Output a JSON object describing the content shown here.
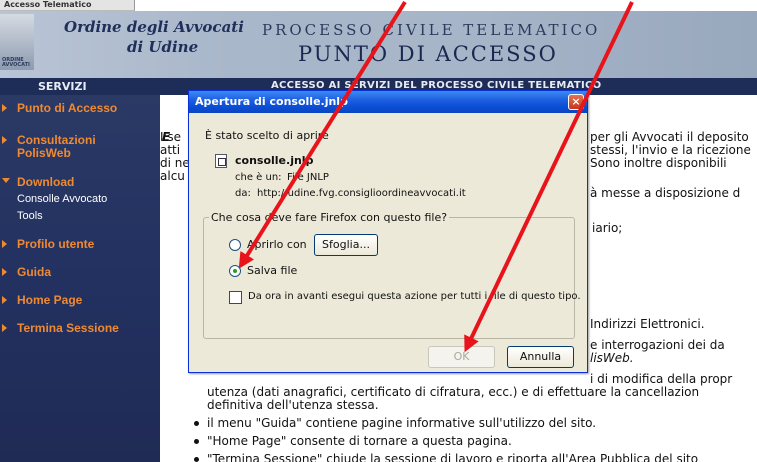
{
  "browser": {
    "tab_title": "Accesso Telematico"
  },
  "header": {
    "crest_label": "ORDINE AVVOCATI",
    "org_line1": "Ordine degli Avvocati",
    "org_line2": "di Udine",
    "pct_line1": "PROCESSO CIVILE TELEMATICO",
    "pct_line2": "PUNTO DI ACCESSO"
  },
  "nav": {
    "servizi_label": "SERVIZI",
    "title": "ACCESSO AI SERVIZI DEL PROCESSO CIVILE TELEMATICO"
  },
  "sidebar": {
    "items": [
      {
        "label": "Punto di Accesso"
      },
      {
        "label": "Consultazioni"
      },
      {
        "label": "PolisWeb"
      },
      {
        "label": "Download"
      },
      {
        "label": "Profilo utente"
      },
      {
        "label": "Guida"
      },
      {
        "label": "Home Page"
      },
      {
        "label": "Termina Sessione"
      }
    ],
    "sub_items": [
      {
        "label": "Consolle Avvocato"
      },
      {
        "label": "Tools"
      }
    ]
  },
  "content": {
    "lines": [
      "I se",
      "atti",
      "di ne",
      "alcu",
      "per gli Avvocati il deposito",
      "stessi, l'invio e la ricezione",
      "Sono inoltre disponibili",
      "à messe a disposizione d",
      "iario;",
      "Indirizzi Elettronici.",
      "e interrogazioni dei da",
      "lisWeb.",
      "i di modifica della propr",
      "utenza (dati anagrafici, certificato di cifratura, ecc.) e di effettuare la cancellazion",
      "definitiva dell'utenza stessa.",
      "il menu \"Guida\" contiene pagine informative sull'utilizzo del sito.",
      "\"Home Page\" consente di tornare a questa pagina.",
      "\"Termina Sessione\" chiude la sessione di lavoro e riporta all'Area Pubblica del sito"
    ],
    "bold_e": "E"
  },
  "dialog": {
    "title": "Apertura di consolle.jnlp",
    "close_glyph": "×",
    "intro": "È stato scelto di aprire",
    "filename": "consolle.jnlp",
    "type_label": "che è un:",
    "type_value": "File JNLP",
    "from_label": "da:",
    "from_value": "http://udine.fvg.consiglioordineavvocati.it",
    "group_title": "Che cosa deve fare Firefox con questo file?",
    "open_with_label": "Aprirlo con",
    "browse_button": "Sfoglia...",
    "save_file_label": "Salva file",
    "remember_label": "Da ora in avanti esegui questa azione per tutti i file di questo tipo.",
    "ok_button": "OK",
    "cancel_button": "Annulla",
    "selected_option": "Salva file",
    "remember_checked": false
  },
  "colors": {
    "sidebar_orange": "#f08a30",
    "nav_dark_blue": "#1e2c58",
    "annotation_red": "#e8141b",
    "xp_title_blue": "#0a4fd6"
  }
}
